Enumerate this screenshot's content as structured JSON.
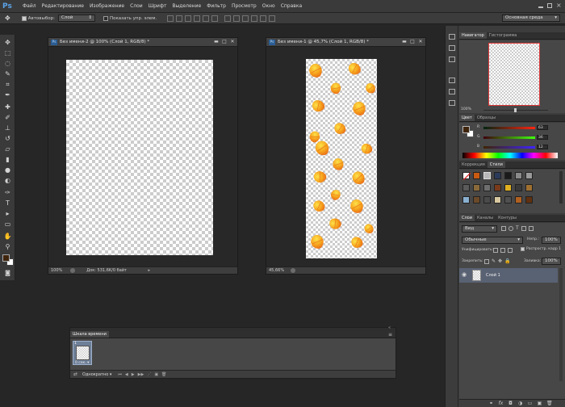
{
  "app": {
    "logo": "Ps"
  },
  "menu": [
    "Файл",
    "Редактирование",
    "Изображение",
    "Слои",
    "Шрифт",
    "Выделение",
    "Фильтр",
    "Просмотр",
    "Окно",
    "Справка"
  ],
  "options_bar": {
    "autoselect_label": "Автовыбор:",
    "autoselect_value": "Слой",
    "show_controls_label": "Показать упр. элем.",
    "workspace": "Основная среда"
  },
  "doc1": {
    "title": "Без имени-2 @ 100% (Слой 1, RGB/8) *",
    "zoom": "100%",
    "info": "Док: 531,6K/0 байт"
  },
  "doc2": {
    "title": "Без имени-1 @ 45,7% (Слой 1, RGB/8) *",
    "zoom": "45,66%"
  },
  "navigator": {
    "tabs": [
      "Навигатор",
      "Гистограмма"
    ],
    "zoom": "100%"
  },
  "color_panel": {
    "tabs": [
      "Цвет",
      "Образцы"
    ],
    "r": "63",
    "g": "36",
    "b": "12",
    "r_label": "R",
    "g_label": "G",
    "b_label": "B"
  },
  "styles_panel": {
    "tabs": [
      "Коррекция",
      "Стили"
    ]
  },
  "layers_panel": {
    "tabs": [
      "Слои",
      "Каналы",
      "Контуры"
    ],
    "kind": "Вид",
    "blend": "Обычные",
    "opacity_label": "Непр.:",
    "opacity": "100%",
    "unify_label": "Унифицировать:",
    "propagate_label": "Распростр. кадр 1",
    "lock_label": "Закрепить:",
    "fill_label": "Заливка:",
    "fill": "100%",
    "layer_name": "Слой 1"
  },
  "timeline": {
    "title": "Шкала времени",
    "frame_time": "0 сек.",
    "frame_number": "1",
    "loop": "Однократно"
  },
  "colors": {
    "fg": "#3f240c",
    "bg": "#ffffff",
    "accent": "#5aa3e8"
  }
}
